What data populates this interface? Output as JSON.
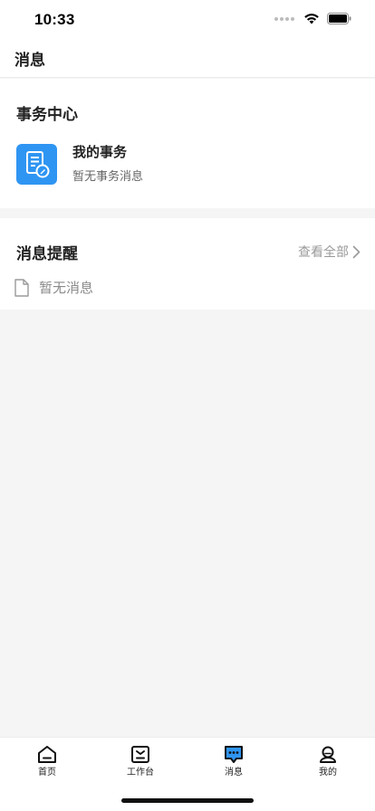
{
  "status_bar": {
    "time": "10:33"
  },
  "header": {
    "title": "消息"
  },
  "affairs": {
    "title": "事务中心",
    "item": {
      "name": "我的事务",
      "description": "暂无事务消息",
      "icon": "document-edit-icon"
    }
  },
  "messages": {
    "title": "消息提醒",
    "view_all_label": "查看全部",
    "empty_text": "暂无消息"
  },
  "tab_bar": {
    "tabs": [
      {
        "label": "首页",
        "icon": "home-icon",
        "active": false
      },
      {
        "label": "工作台",
        "icon": "workbench-icon",
        "active": false
      },
      {
        "label": "消息",
        "icon": "message-icon",
        "active": true
      },
      {
        "label": "我的",
        "icon": "profile-icon",
        "active": false
      }
    ]
  },
  "colors": {
    "accent": "#2f95f2",
    "background": "#f5f5f5",
    "muted_text": "#9a9a9a"
  }
}
